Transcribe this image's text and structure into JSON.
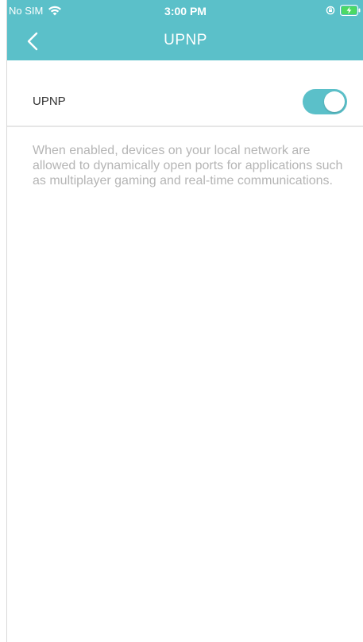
{
  "status_bar": {
    "carrier": "No SIM",
    "time": "3:00 PM",
    "icons": [
      "wifi-icon",
      "orientation-lock-icon",
      "battery-charging-icon"
    ]
  },
  "header": {
    "title": "UPNP",
    "back_icon": "chevron-left-icon"
  },
  "settings": {
    "upnp_label": "UPNP",
    "upnp_enabled": true,
    "description": "When enabled, devices on your local network are allowed to dynamically open ports for applications such as multiplayer gaming and real-time communications."
  },
  "colors": {
    "accent": "#5bc0c9",
    "description_text": "#b5b5b5",
    "label_text": "#333333",
    "battery": "#4cd964"
  }
}
